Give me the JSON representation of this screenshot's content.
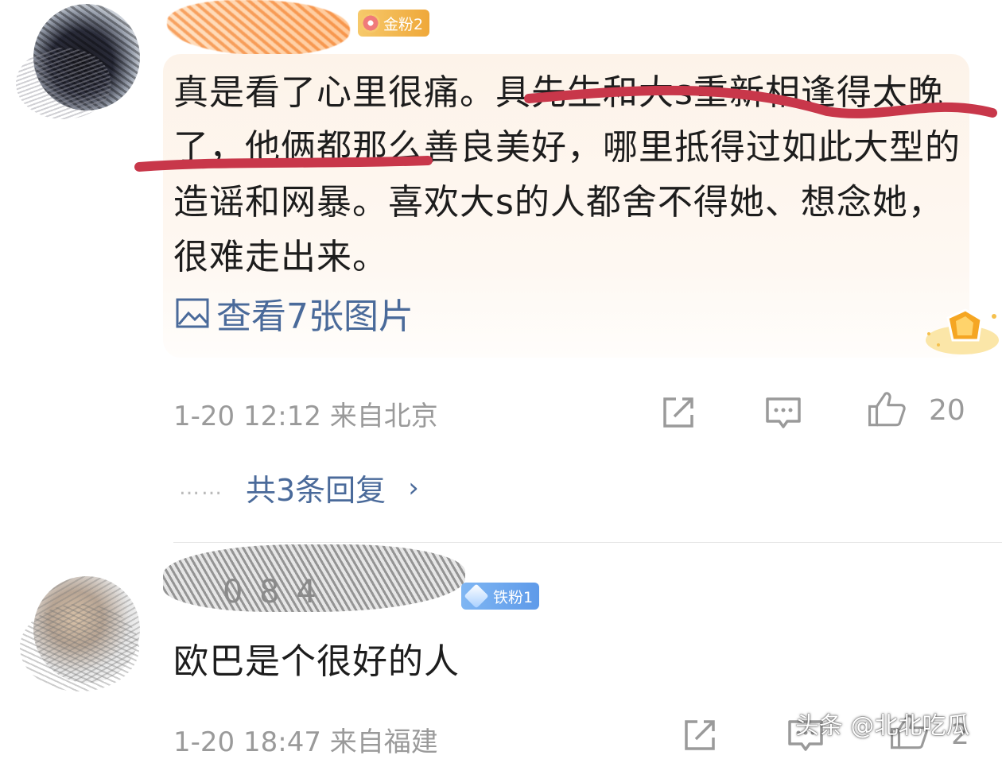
{
  "comment1": {
    "badge": "金粉2",
    "text": "真是看了心里很痛。具先生和大s重新相逢得太晚了，他俩都那么善良美好，哪里抵得过如此大型的造谣和网暴。喜欢大s的人都舍不得她、想念她，很难走出来。",
    "view_images": "查看7张图片",
    "time_location": "1-20 12:12  来自北京",
    "likes": "20",
    "replies_dots": "……",
    "replies_link": "共3条回复",
    "replies_chevron": "›"
  },
  "comment2": {
    "username_partial": "0 8 4",
    "badge": "铁粉1",
    "text": "欧巴是个很好的人",
    "time_location": "1-20 18:47  来自福建",
    "likes": "2"
  },
  "watermark": "头条 @北北吃瓜",
  "colors": {
    "link": "#4a6a9a",
    "underline": "#c8374a",
    "gold_badge": "#efa83a",
    "iron_badge": "#5e9ae9",
    "bubble_bg": "#fdf3e9",
    "meta_gray": "#9a9a9a"
  },
  "icons": {
    "share": "share-icon",
    "comment": "comment-icon",
    "like": "thumbs-up-icon",
    "image": "image-icon",
    "medal": "medal-icon"
  }
}
